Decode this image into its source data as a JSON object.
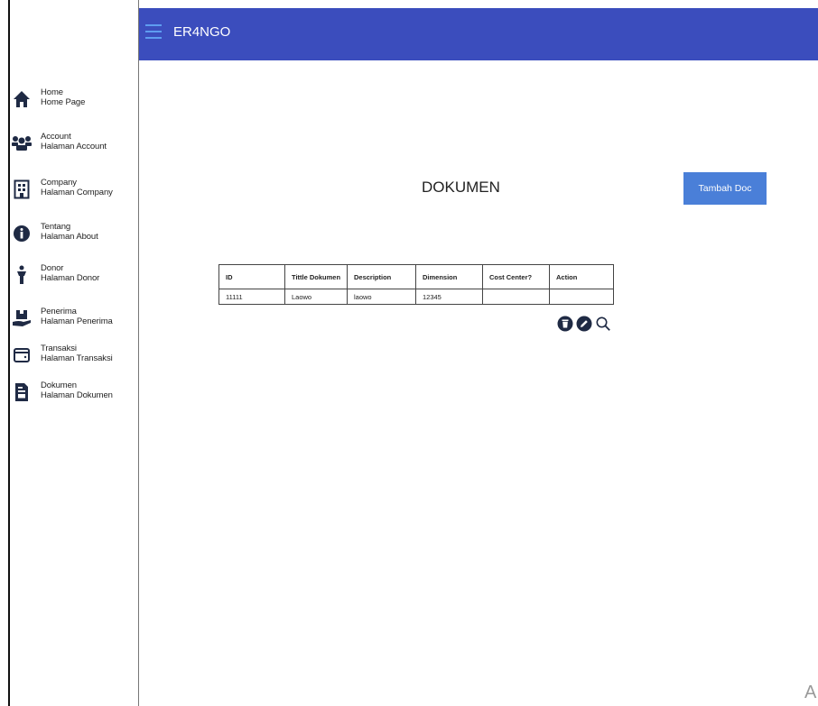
{
  "app": {
    "title": "ER4NGO"
  },
  "sidebar": {
    "items": [
      {
        "title": "Home",
        "subtitle": "Home Page",
        "icon": "home-icon"
      },
      {
        "title": "Account",
        "subtitle": "Halaman Account",
        "icon": "users-icon"
      },
      {
        "title": "Company",
        "subtitle": "Halaman Company",
        "icon": "building-icon"
      },
      {
        "title": "Tentang",
        "subtitle": "Halaman About",
        "icon": "info-icon"
      },
      {
        "title": "Donor",
        "subtitle": "Halaman Donor",
        "icon": "donor-person-icon"
      },
      {
        "title": "Penerima",
        "subtitle": "Halaman Penerima",
        "icon": "hand-box-icon"
      },
      {
        "title": "Transaksi",
        "subtitle": "Halaman Transaksi",
        "icon": "wallet-icon"
      },
      {
        "title": "Dokumen",
        "subtitle": "Halaman Dokumen",
        "icon": "document-icon"
      }
    ]
  },
  "main": {
    "heading": "DOKUMEN",
    "add_button": "Tambah Doc",
    "table": {
      "columns": [
        "ID",
        "Tittle Dokumen",
        "Description",
        "Dimension",
        "Cost Center?",
        "Action"
      ],
      "rows": [
        [
          "11111",
          "Laowo",
          "laowo",
          "12345",
          "",
          ""
        ]
      ]
    },
    "row_actions": [
      "trash-icon",
      "edit-icon",
      "search-icon"
    ]
  },
  "watermark_char": "A",
  "colors": {
    "topbar": "#3b4dbd",
    "button": "#4a7fd8",
    "hamburger": "#5e9df0",
    "icon": "#1f2a44"
  }
}
